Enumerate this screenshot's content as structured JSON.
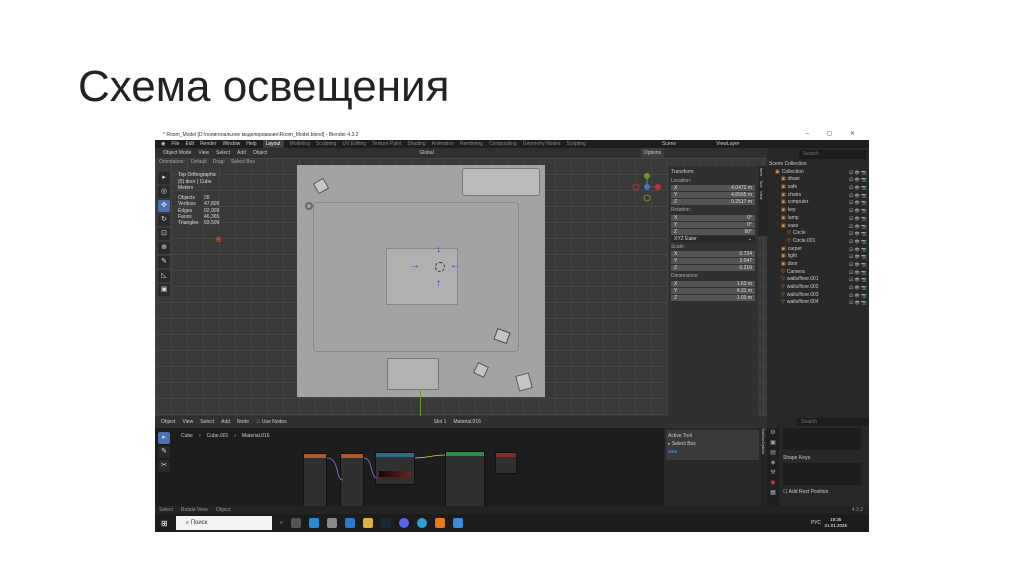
{
  "slide": {
    "title": "Схема освещения"
  },
  "window": {
    "title": "* Room_Model [D:\\полигональное моделирование\\Room_Model.blend] - Blender 4.3.2",
    "controls": "– ▢ ✕"
  },
  "menu": [
    "File",
    "Edit",
    "Render",
    "Window",
    "Help"
  ],
  "workspaces": [
    "Layout",
    "Modeling",
    "Sculpting",
    "UV Editing",
    "Texture Paint",
    "Shading",
    "Animation",
    "Rendering",
    "Compositing",
    "Geometry Nodes",
    "Scripting"
  ],
  "scene": {
    "scene": "Scene",
    "view_layer": "ViewLayer"
  },
  "header": {
    "mode": "Object Mode",
    "items": [
      "View",
      "Select",
      "Add",
      "Object"
    ],
    "transform": "Global",
    "options": "Options"
  },
  "header2": {
    "orientation_label": "Orientation:",
    "orientation": "Default",
    "drag_label": "Drag:",
    "drag": "Select Box"
  },
  "overlay": {
    "view": "Top Orthographic",
    "object": "(0) door | Cube",
    "units": "Meters"
  },
  "stats": [
    [
      "Objects",
      "28"
    ],
    [
      "Vertices",
      "47,809"
    ],
    [
      "Edges",
      "92,909"
    ],
    [
      "Faces",
      "46,365"
    ],
    [
      "Triangles",
      "93,509"
    ]
  ],
  "npanel": {
    "section": "Transform",
    "location_label": "Location:",
    "location": [
      [
        "X",
        "4.0472 m"
      ],
      [
        "Y",
        "4.8505 m"
      ],
      [
        "Z",
        "0.2517 m"
      ]
    ],
    "rotation_label": "Rotation:",
    "rotation": [
      [
        "X",
        "0°"
      ],
      [
        "Y",
        "0°"
      ],
      [
        "Z",
        "90°"
      ]
    ],
    "rotation_mode": "XYZ Euler",
    "scale_label": "Scale:",
    "scale": [
      [
        "X",
        "0.734"
      ],
      [
        "Y",
        "2.047"
      ],
      [
        "Z",
        "0.216"
      ]
    ],
    "dimensions_label": "Dimensions:",
    "dimensions": [
      [
        "X",
        "1.63 m"
      ],
      [
        "Y",
        "4.31 m"
      ],
      [
        "Z",
        "1.03 m"
      ]
    ],
    "tabs": [
      "Item",
      "Tool",
      "View"
    ]
  },
  "outliner": {
    "search_placeholder": "Search",
    "root": "Scene Collection",
    "items": [
      "Collection",
      "divan",
      "safe",
      "chairs",
      "computer",
      "key",
      "lamp",
      "vase",
      "Circle",
      "Circle.001",
      "carpet",
      "light",
      "door",
      "Camera",
      "walls/floor.001",
      "walls/floor.002",
      "walls/floor.003",
      "walls/floor.004"
    ]
  },
  "node_editor": {
    "type": "Object",
    "items": [
      "View",
      "Select",
      "Add",
      "Node"
    ],
    "use_nodes": "Use Nodes",
    "slot": "Slot 1",
    "material": "Material.016",
    "breadcrumb": [
      "Cube",
      "Cube.001",
      "Material.016"
    ]
  },
  "active_tool": {
    "section": "Active Tool",
    "tool": "Select Box",
    "tabs": [
      "Tool",
      "View",
      "Options"
    ]
  },
  "properties": {
    "search_placeholder": "Search",
    "shape_keys": "Shape Keys",
    "add_rest": "Add Rest Position"
  },
  "statusbar": {
    "items": [
      "Select",
      "Rotate View",
      "Object"
    ],
    "version": "4.3.2"
  },
  "taskbar": {
    "search": "Поиск",
    "lang": "РУС",
    "time": "19:36",
    "date": "21.01.2025"
  }
}
